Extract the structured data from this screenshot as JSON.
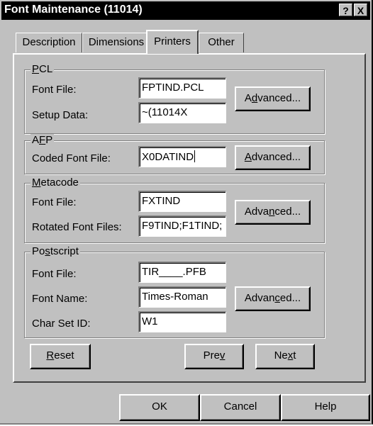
{
  "window": {
    "title": "Font Maintenance (11014)",
    "help_glyph": "?",
    "close_glyph": "X"
  },
  "tabs": [
    {
      "label": "Description"
    },
    {
      "label": "Dimensions"
    },
    {
      "label": "Printers",
      "active": true
    },
    {
      "label": "Other"
    }
  ],
  "pcl": {
    "group_label_pre": "",
    "group_label_mn": "P",
    "group_label_post": "CL",
    "font_file_label": "Font File:",
    "font_file_value": "FPTIND.PCL",
    "setup_data_label": "Setup Data:",
    "setup_data_value": "~(11014X",
    "advanced_pre": "A",
    "advanced_mn": "d",
    "advanced_post": "vanced..."
  },
  "afp": {
    "group_label_pre": "A",
    "group_label_mn": "F",
    "group_label_post": "P",
    "coded_font_label": "Coded Font File:",
    "coded_font_value": "X0DATIND",
    "advanced_pre": "",
    "advanced_mn": "A",
    "advanced_post": "dvanced..."
  },
  "metacode": {
    "group_label_pre": "",
    "group_label_mn": "M",
    "group_label_post": "etacode",
    "font_file_label": "Font File:",
    "font_file_value": "FXTIND",
    "rotated_label": "Rotated Font Files:",
    "rotated_value": "F9TIND;F1TIND;",
    "advanced_pre": "Adva",
    "advanced_mn": "n",
    "advanced_post": "ced..."
  },
  "postscript": {
    "group_label_pre": "Po",
    "group_label_mn": "s",
    "group_label_post": "tscript",
    "font_file_label": "Font File:",
    "font_file_value": "TIR____.PFB",
    "font_name_label": "Font Name:",
    "font_name_value": "Times-Roman",
    "char_set_label": "Char Set ID:",
    "char_set_value": "W1",
    "advanced_pre": "Advan",
    "advanced_mn": "c",
    "advanced_post": "ed..."
  },
  "nav": {
    "reset_pre": "",
    "reset_mn": "R",
    "reset_post": "eset",
    "prev_pre": "Pre",
    "prev_mn": "v",
    "prev_post": "",
    "next_pre": "Ne",
    "next_mn": "x",
    "next_post": "t"
  },
  "footer": {
    "ok_label": "OK",
    "cancel_label": "Cancel",
    "help_label": "Help"
  }
}
